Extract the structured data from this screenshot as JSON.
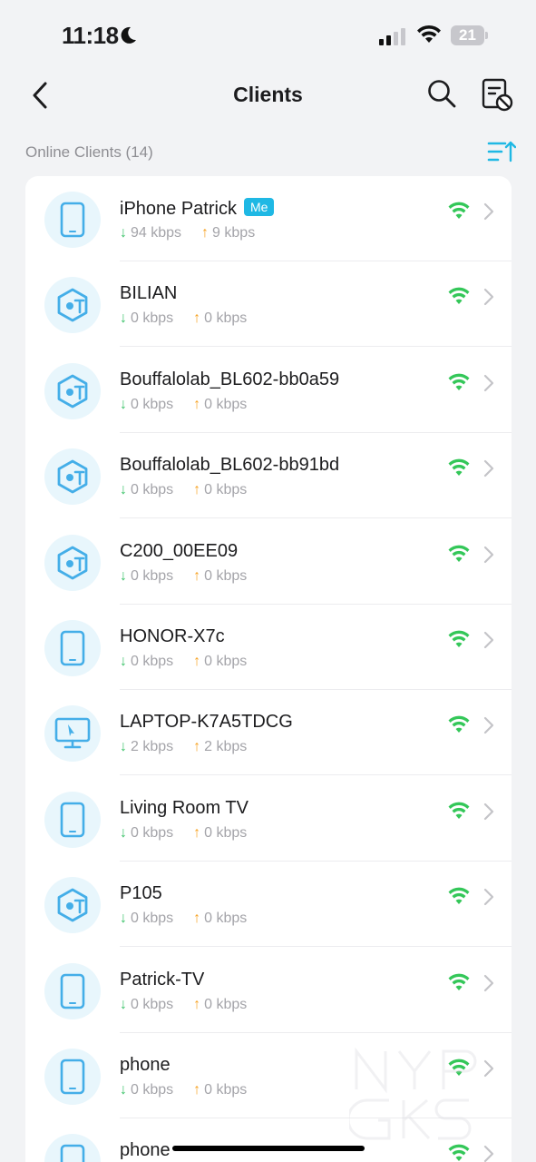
{
  "status_bar": {
    "time": "11:18",
    "battery": "21"
  },
  "nav": {
    "title": "Clients"
  },
  "section": {
    "label": "Online Clients (14)"
  },
  "colors": {
    "accent": "#1fb8e4",
    "wifi": "#34c759",
    "download": "#3cc36a",
    "upload": "#f7a325"
  },
  "clients": [
    {
      "name": "iPhone Patrick",
      "badge": "Me",
      "icon": "phone-icon",
      "down": "94 kbps",
      "up": "9 kbps"
    },
    {
      "name": "BILIAN",
      "icon": "iot-icon",
      "down": "0 kbps",
      "up": "0 kbps"
    },
    {
      "name": "Bouffalolab_BL602-bb0a59",
      "icon": "iot-icon",
      "down": "0 kbps",
      "up": "0 kbps"
    },
    {
      "name": "Bouffalolab_BL602-bb91bd",
      "icon": "iot-icon",
      "down": "0 kbps",
      "up": "0 kbps"
    },
    {
      "name": "C200_00EE09",
      "icon": "iot-icon",
      "down": "0 kbps",
      "up": "0 kbps"
    },
    {
      "name": "HONOR-X7c",
      "icon": "phone-icon",
      "down": "0 kbps",
      "up": "0 kbps"
    },
    {
      "name": "LAPTOP-K7A5TDCG",
      "icon": "computer-icon",
      "down": "2 kbps",
      "up": "2 kbps"
    },
    {
      "name": "Living Room TV",
      "icon": "phone-icon",
      "down": "0 kbps",
      "up": "0 kbps"
    },
    {
      "name": "P105",
      "icon": "iot-icon",
      "down": "0 kbps",
      "up": "0 kbps"
    },
    {
      "name": "Patrick-TV",
      "icon": "phone-icon",
      "down": "0 kbps",
      "up": "0 kbps"
    },
    {
      "name": "phone",
      "icon": "phone-icon",
      "down": "0 kbps",
      "up": "0 kbps"
    },
    {
      "name": "phone",
      "icon": "phone-icon",
      "down": "",
      "up": ""
    }
  ]
}
